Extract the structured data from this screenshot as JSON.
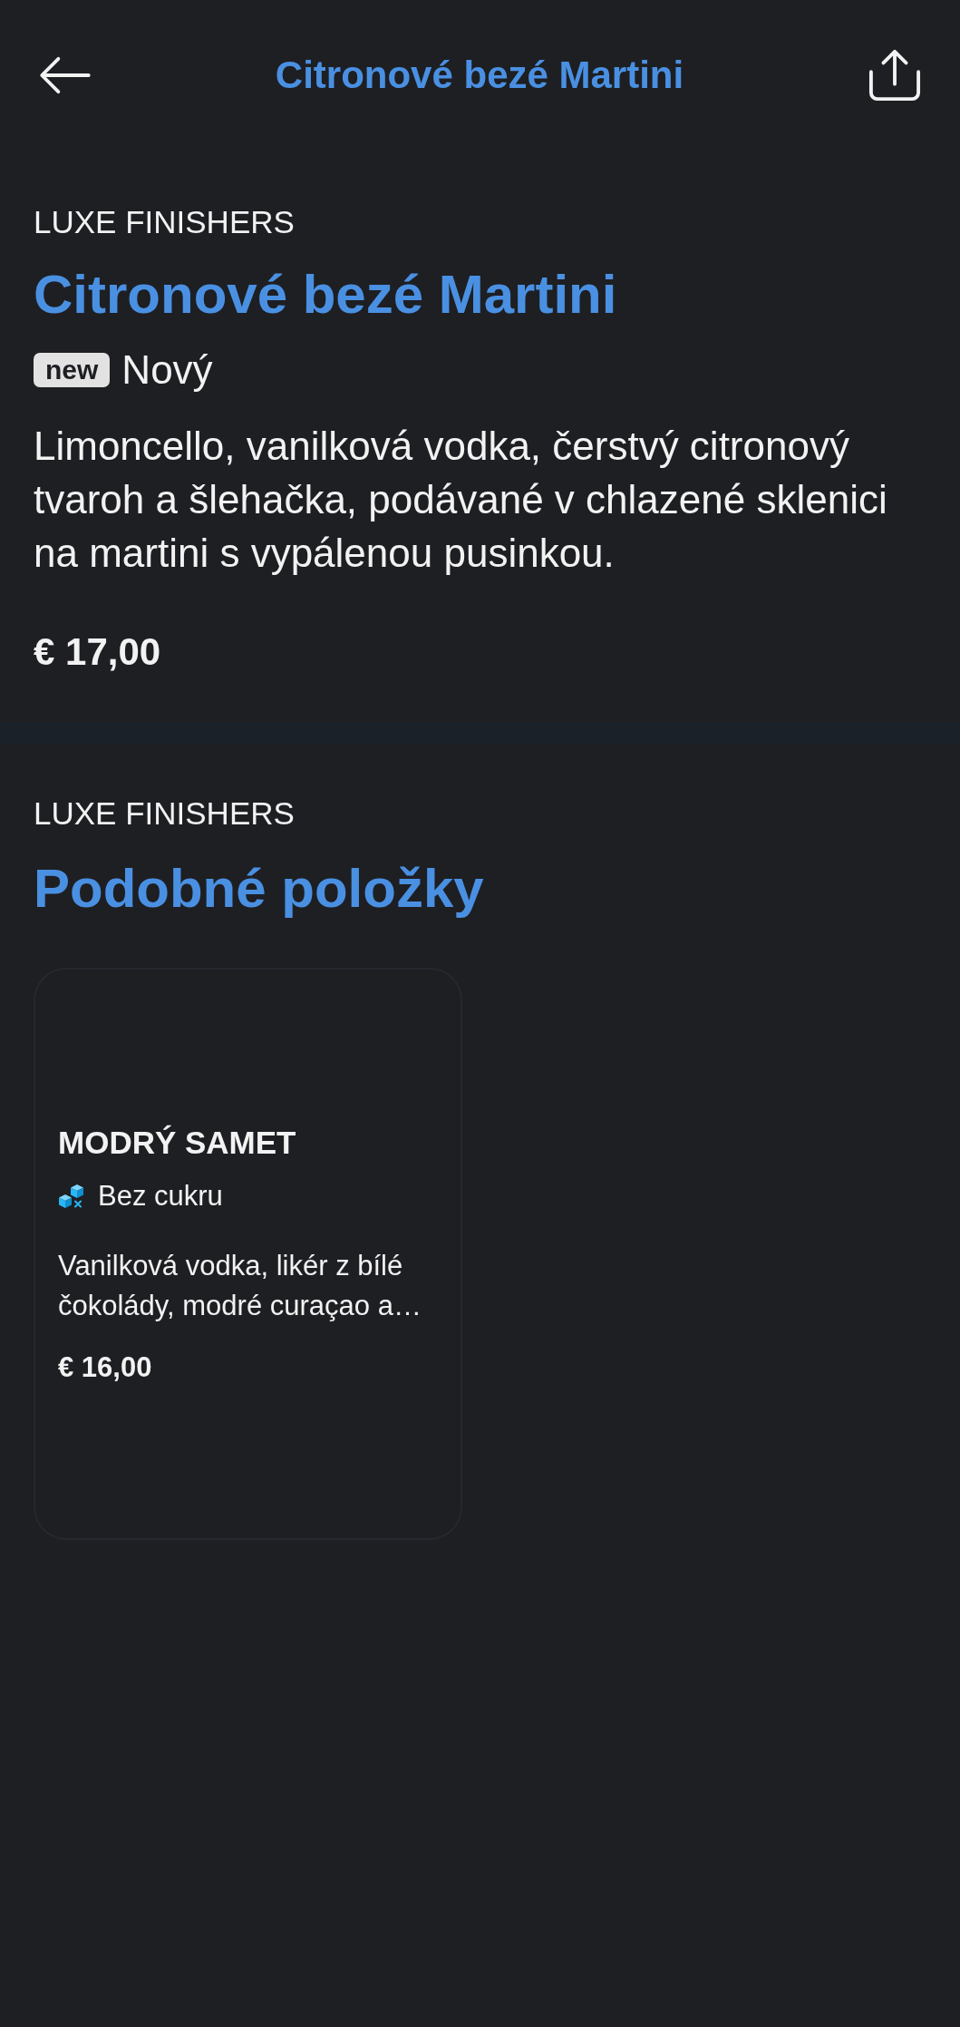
{
  "header": {
    "title": "Citronové bezé Martini"
  },
  "item": {
    "category": "LUXE FINISHERS",
    "name": "Citronové bezé Martini",
    "badges": [
      {
        "kind": "new",
        "label": "new",
        "text": "Nový"
      }
    ],
    "description": "Limoncello, vanilková vodka, čerstvý citronový tvaroh a šlehačka, podávané v chlazené sklenici na martini s vypálenou pusinkou.",
    "price": "€ 17,00"
  },
  "similar": {
    "category": "LUXE FINISHERS",
    "title": "Podobné položky",
    "items": [
      {
        "name": "MODRÝ SAMET",
        "tags": [
          {
            "kind": "sugar_free",
            "label": "Bez cukru"
          }
        ],
        "description": "Vanilková vodka, likér z bílé čokolády, modré curaçao a…",
        "price": "€ 16,00"
      }
    ]
  }
}
